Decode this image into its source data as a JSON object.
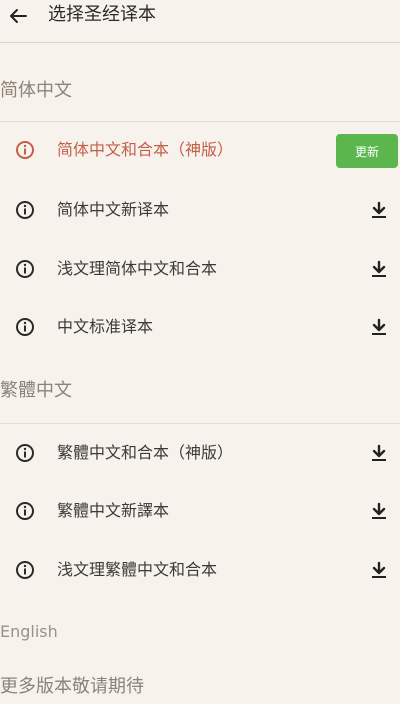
{
  "header": {
    "title": "选择圣经译本",
    "back_icon": "arrow-left-icon"
  },
  "sections": {
    "simplified": {
      "title": "简体中文",
      "items": [
        {
          "label": "简体中文和合本（神版）",
          "action": "更新",
          "active": true
        },
        {
          "label": "简体中文新译本"
        },
        {
          "label": "浅文理简体中文和合本"
        },
        {
          "label": "中文标准译本"
        }
      ]
    },
    "traditional": {
      "title": "繁體中文",
      "items": [
        {
          "label": "繁體中文和合本（神版）"
        },
        {
          "label": "繁體中文新譯本"
        },
        {
          "label": "浅文理繁體中文和合本"
        }
      ]
    },
    "english": {
      "title": "English"
    }
  },
  "footer": {
    "more": "更多版本敬请期待"
  },
  "colors": {
    "active_text": "#c45f4a",
    "update_button": "#5ab64d",
    "section_header": "#8c8378"
  }
}
